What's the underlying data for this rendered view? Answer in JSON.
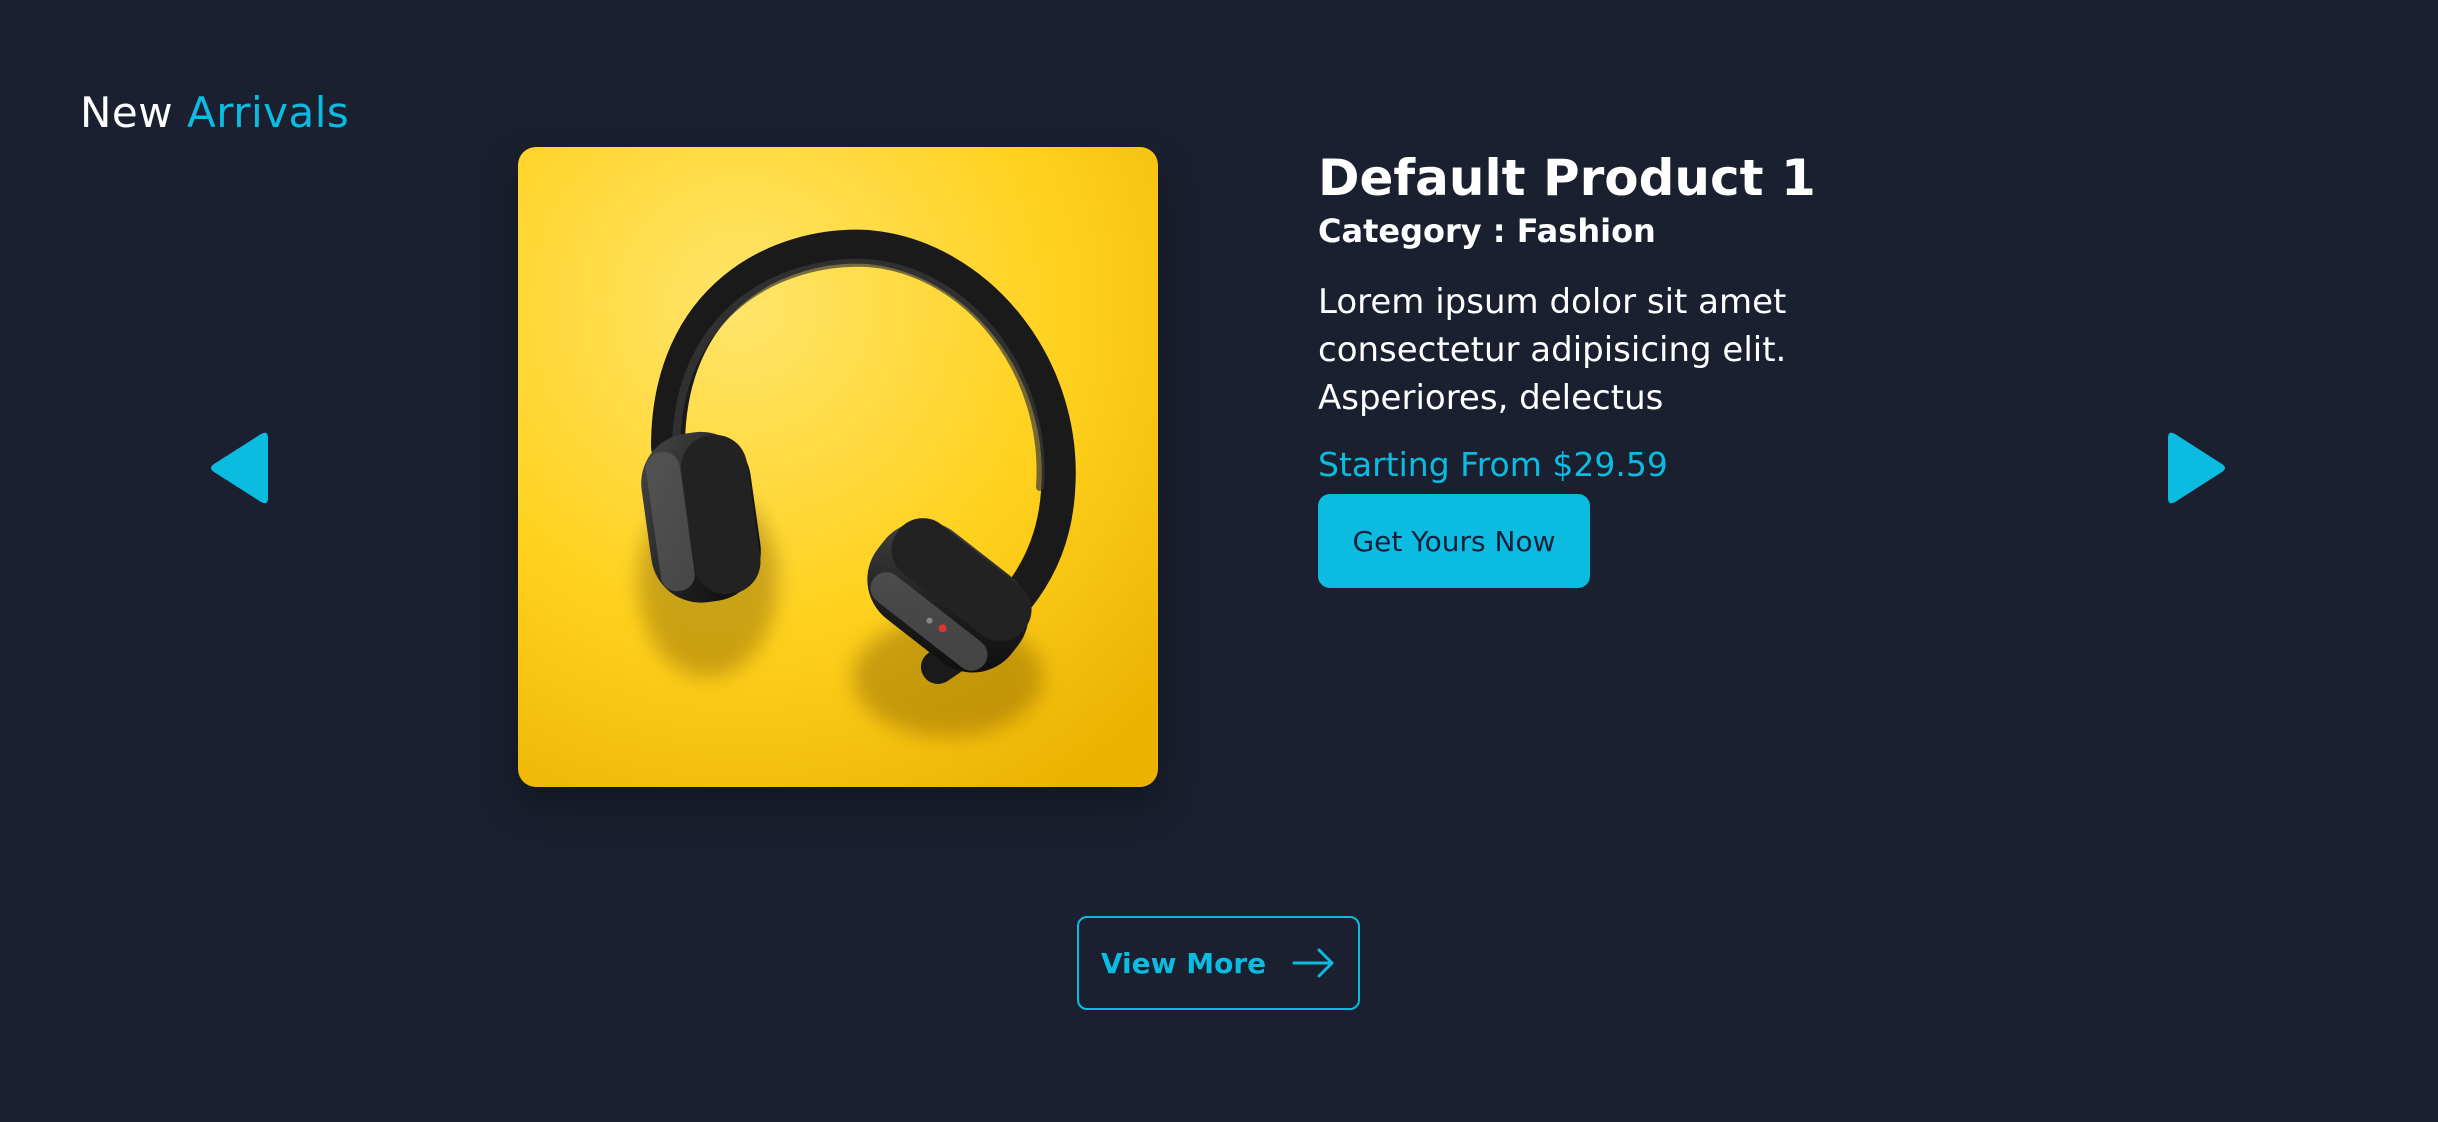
{
  "section": {
    "title_word1": "New",
    "title_word2": "Arrivals"
  },
  "product": {
    "name": "Default Product 1",
    "category_label": "Category : Fashion",
    "description": "Lorem ipsum dolor sit amet consectetur adipisicing elit. Asperiores, delectus",
    "price_text": "Starting From $29.59",
    "cta_label": "Get Yours Now",
    "image_icon": "headphones-image"
  },
  "navigation": {
    "prev_icon": "triangle-left-icon",
    "next_icon": "triangle-right-icon"
  },
  "footer": {
    "view_more_label": "View More",
    "view_more_icon": "arrow-right-icon"
  },
  "colors": {
    "background": "#1b2030",
    "accent": "#0bbbe0",
    "text": "#ffffff",
    "image_yellow": "#ffd21f"
  }
}
